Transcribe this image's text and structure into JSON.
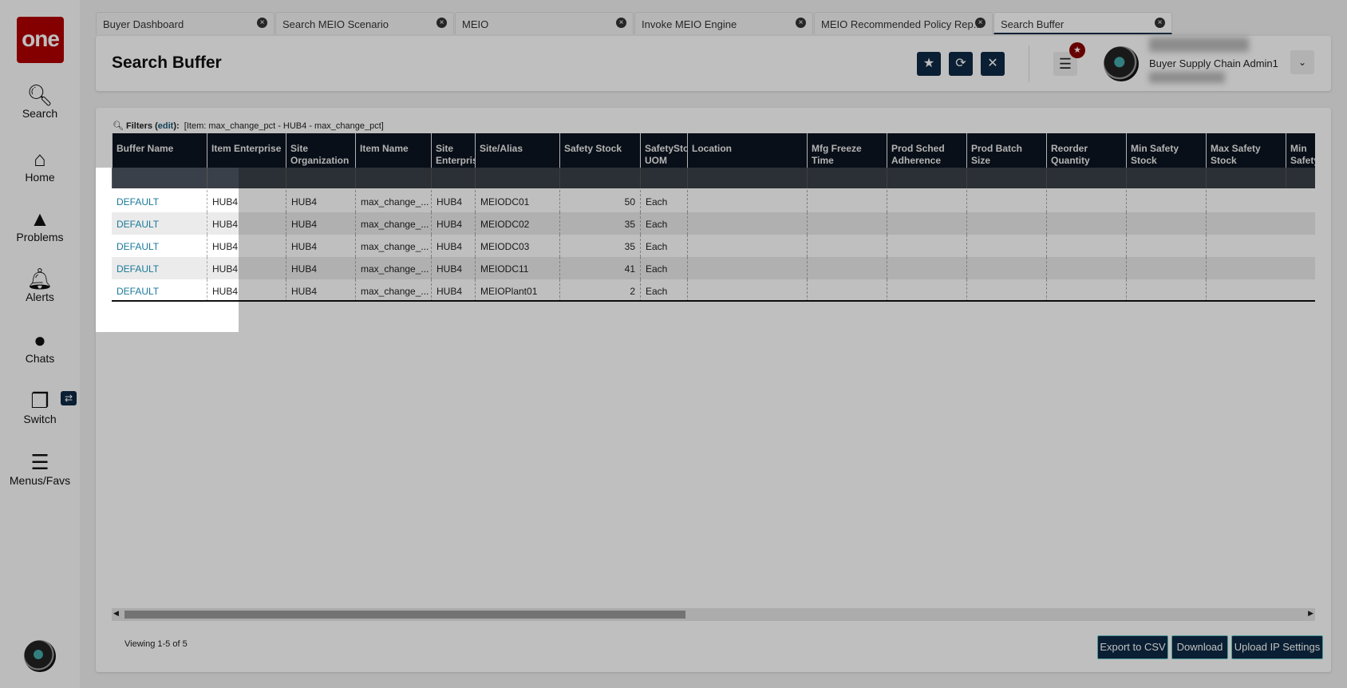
{
  "logo": "one",
  "sidebar": {
    "items": [
      {
        "label": "Search",
        "icon": "search-icon",
        "glyph": "🔍︎"
      },
      {
        "label": "Home",
        "icon": "home-icon",
        "glyph": "⌂"
      },
      {
        "label": "Problems",
        "icon": "warning-icon",
        "glyph": "▲"
      },
      {
        "label": "Alerts",
        "icon": "bell-icon",
        "glyph": "🔔︎"
      },
      {
        "label": "Chats",
        "icon": "chat-icon",
        "glyph": "●"
      },
      {
        "label": "Switch",
        "icon": "switch-icon",
        "glyph": "❐"
      },
      {
        "label": "Menus/Favs",
        "icon": "menu-icon",
        "glyph": "☰"
      }
    ],
    "switch_badge": "⇄"
  },
  "tabs": [
    "Buyer Dashboard",
    "Search MEIO Scenario",
    "MEIO",
    "Invoke MEIO Engine",
    "MEIO Recommended Policy Rep...",
    "Search Buffer"
  ],
  "header": {
    "title": "Search Buffer",
    "user": "Buyer Supply Chain Admin1"
  },
  "filters": {
    "label": "Filters",
    "edit": "edit",
    "text": "[Item: max_change_pct - HUB4 - max_change_pct]"
  },
  "columns": [
    "Buffer Name",
    "Item Enterprise",
    "Site Organization",
    "Item Name",
    "Site Enterprise",
    "Site/Alias",
    "Safety Stock",
    "SafetyStock UOM",
    "Location",
    "Mfg Freeze Time",
    "Prod Sched Adherence",
    "Prod Batch Size",
    "Reorder Quantity",
    "Min Safety Stock",
    "Max Safety Stock",
    "Min Safety Stock"
  ],
  "rows": [
    [
      "DEFAULT",
      "HUB4",
      "HUB4",
      "max_change_...",
      "HUB4",
      "MEIODC01",
      "50",
      "Each"
    ],
    [
      "DEFAULT",
      "HUB4",
      "HUB4",
      "max_change_...",
      "HUB4",
      "MEIODC02",
      "35",
      "Each"
    ],
    [
      "DEFAULT",
      "HUB4",
      "HUB4",
      "max_change_...",
      "HUB4",
      "MEIODC03",
      "35",
      "Each"
    ],
    [
      "DEFAULT",
      "HUB4",
      "HUB4",
      "max_change_...",
      "HUB4",
      "MEIODC11",
      "41",
      "Each"
    ],
    [
      "DEFAULT",
      "HUB4",
      "HUB4",
      "max_change_...",
      "HUB4",
      "MEIOPlant01",
      "2",
      "Each"
    ]
  ],
  "footer": {
    "viewing": "Viewing 1-5 of 5",
    "buttons": [
      "Export to CSV",
      "Download",
      "Upload IP Settings"
    ]
  },
  "colors": {
    "accent": "#0e2a44",
    "brand": "#b00000",
    "link": "#1a7a9a"
  }
}
